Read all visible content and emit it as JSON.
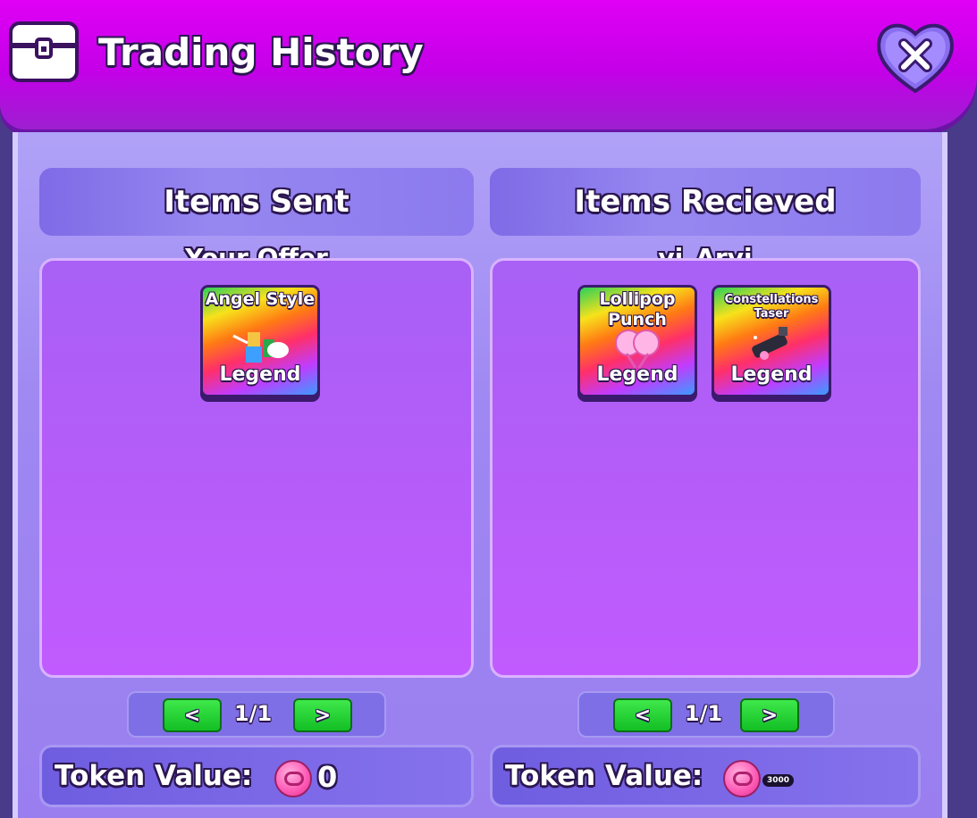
{
  "header": {
    "title": "Trading History",
    "icon": "chest-icon",
    "close_icon": "close-heart-icon"
  },
  "sent": {
    "heading": "Items Sent",
    "subtitle": "Your Offer",
    "items": [
      {
        "name": "Angel Style",
        "rarity": "Legend"
      }
    ],
    "page": "1/1",
    "prev_label": "<",
    "next_label": ">",
    "token_label": "Token Value:",
    "token_value": "0"
  },
  "received": {
    "heading": "Items Recieved",
    "subtitle": "vi_Arvi",
    "items": [
      {
        "name": "Lollipop Punch",
        "rarity": "Legend"
      },
      {
        "name": "Constellations Taser",
        "rarity": "Legend"
      }
    ],
    "page": "1/1",
    "prev_label": "<",
    "next_label": ">",
    "token_label": "Token Value:",
    "token_value": "3000"
  },
  "colors": {
    "header": "#d400f0",
    "panel": "#a896f4",
    "item_box": "#b75cf9",
    "button_green": "#1fd22f",
    "coin": "#ff5fb8"
  }
}
